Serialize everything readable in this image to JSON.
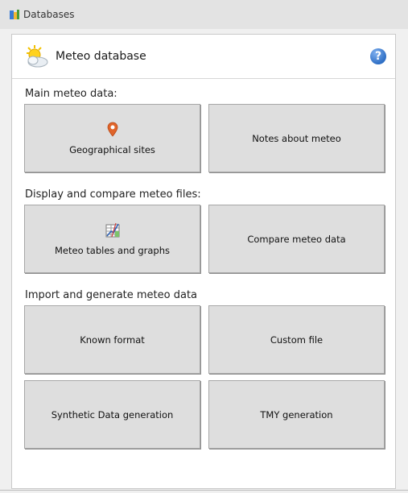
{
  "window": {
    "title": "Databases"
  },
  "header": {
    "title": "Meteo database",
    "help_glyph": "?"
  },
  "sections": {
    "main": {
      "label": "Main meteo data:",
      "buttons": [
        {
          "label": "Geographical sites",
          "icon": "map-pin-icon"
        },
        {
          "label": "Notes about meteo"
        }
      ]
    },
    "display": {
      "label": "Display and compare meteo files:",
      "buttons": [
        {
          "label": "Meteo tables and graphs",
          "icon": "table-graph-icon"
        },
        {
          "label": "Compare meteo data"
        }
      ]
    },
    "import": {
      "label": "Import and generate meteo data",
      "buttons": [
        {
          "label": "Known format"
        },
        {
          "label": "Custom file"
        },
        {
          "label": "Synthetic Data generation"
        },
        {
          "label": "TMY generation"
        }
      ]
    }
  },
  "icons": {
    "app": "database-icon",
    "header": "sun-cloud-icon",
    "help": "help-icon"
  },
  "colors": {
    "button_bg": "#dedede",
    "pin": "#e0642a",
    "help": "#2f6fc5"
  }
}
